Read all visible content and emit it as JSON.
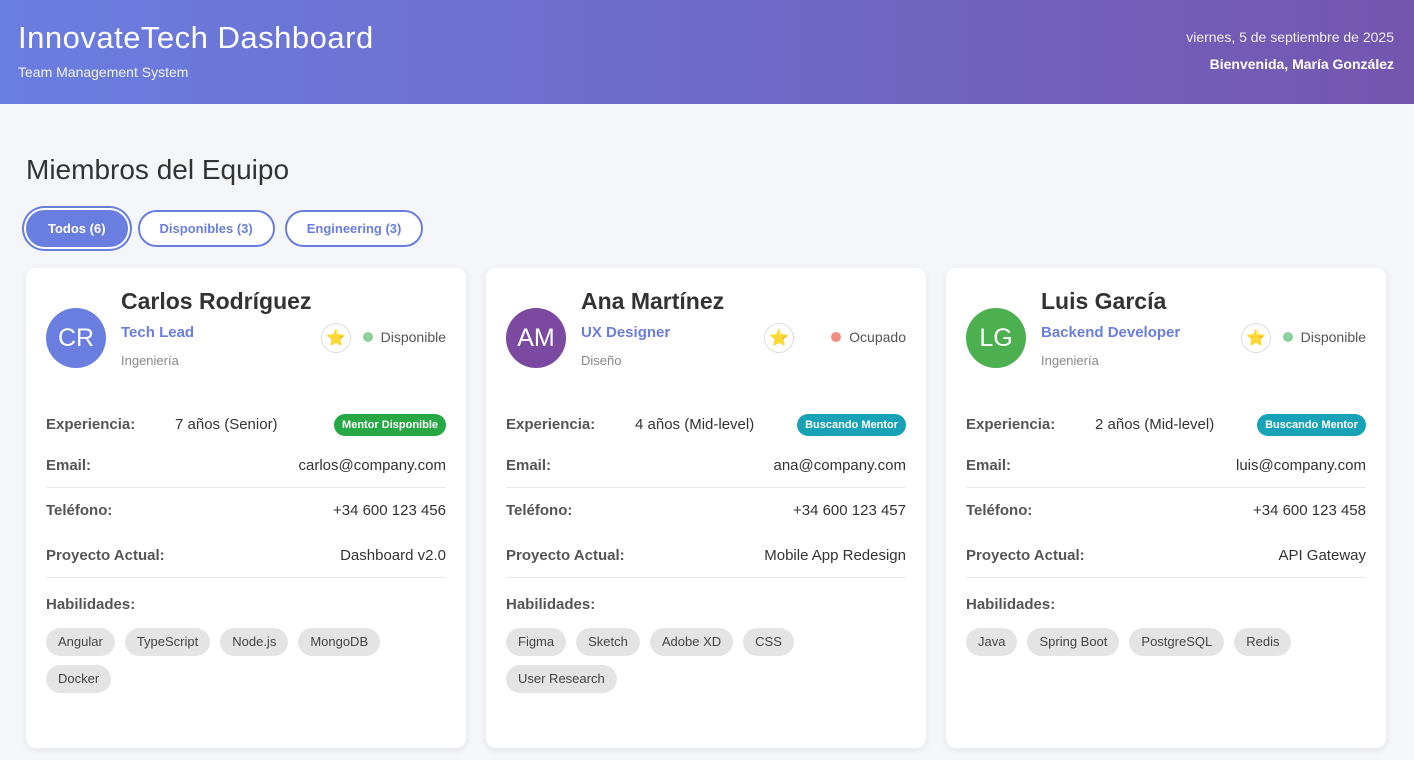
{
  "header": {
    "title": "InnovateTech Dashboard",
    "subtitle": "Team Management System",
    "date": "viernes, 5 de septiembre de 2025",
    "welcome": "Bienvenida, María González"
  },
  "section_title": "Miembros del Equipo",
  "filters": [
    {
      "label": "Todos (6)",
      "active": true
    },
    {
      "label": "Disponibles (3)",
      "active": false
    },
    {
      "label": "Engineering (3)",
      "active": false
    }
  ],
  "labels": {
    "experience": "Experiencia:",
    "email": "Email:",
    "phone": "Teléfono:",
    "project": "Proyecto Actual:",
    "skills": "Habilidades:"
  },
  "colors": {
    "accent": "#6a7ee0",
    "available": "#8fd19e",
    "busy": "#f28b82",
    "mentor_available": "#28a745",
    "seeking_mentor": "#17a2b8"
  },
  "members": [
    {
      "initials": "CR",
      "avatar_color": "#6a7ee0",
      "name": "Carlos Rodríguez",
      "role": "Tech Lead",
      "department": "Ingeniería",
      "status": "Disponible",
      "status_color": "#8fd19e",
      "experience": "7 años (Senior)",
      "badge": "Mentor Disponible",
      "badge_color": "#28a745",
      "email": "carlos@company.com",
      "phone": "+34 600 123 456",
      "project": "Dashboard v2.0",
      "skills": [
        "Angular",
        "TypeScript",
        "Node.js",
        "MongoDB",
        "Docker"
      ]
    },
    {
      "initials": "AM",
      "avatar_color": "#7b4aa0",
      "name": "Ana Martínez",
      "role": "UX Designer",
      "department": "Diseño",
      "status": "Ocupado",
      "status_color": "#f28b82",
      "experience": "4 años (Mid-level)",
      "badge": "Buscando Mentor",
      "badge_color": "#17a2b8",
      "email": "ana@company.com",
      "phone": "+34 600 123 457",
      "project": "Mobile App Redesign",
      "skills": [
        "Figma",
        "Sketch",
        "Adobe XD",
        "CSS",
        "User Research"
      ]
    },
    {
      "initials": "LG",
      "avatar_color": "#4caf50",
      "name": "Luis García",
      "role": "Backend Developer",
      "department": "Ingeniería",
      "status": "Disponible",
      "status_color": "#8fd19e",
      "experience": "2 años (Mid-level)",
      "badge": "Buscando Mentor",
      "badge_color": "#17a2b8",
      "email": "luis@company.com",
      "phone": "+34 600 123 458",
      "project": "API Gateway",
      "skills": [
        "Java",
        "Spring Boot",
        "PostgreSQL",
        "Redis"
      ]
    }
  ]
}
